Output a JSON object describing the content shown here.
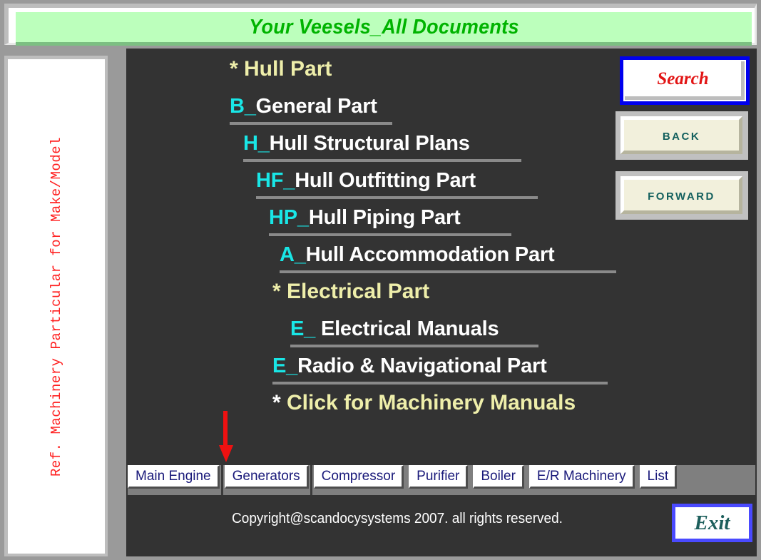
{
  "header": {
    "title": "Your Veesels_All Documents"
  },
  "sidebar": {
    "label": "Ref. Machinery Particular for Make/Model"
  },
  "main": {
    "menu": [
      {
        "kind": "section",
        "star": "*",
        "star_color": "cream",
        "text": "Hull Part",
        "indent": "ind-sec0"
      },
      {
        "kind": "item",
        "code": "B_",
        "label": "General Part",
        "indent": "ind-0",
        "rule_width": 228
      },
      {
        "kind": "item",
        "code": "H_",
        "label": "Hull Structural Plans",
        "indent": "ind-1",
        "rule_width": 390
      },
      {
        "kind": "item",
        "code": "HF_",
        "label": "Hull Outfitting Part",
        "indent": "ind-2",
        "rule_width": 395
      },
      {
        "kind": "item",
        "code": "HP_",
        "label": "Hull Piping Part",
        "indent": "ind-3",
        "rule_width": 340
      },
      {
        "kind": "item",
        "code": "A_",
        "label": "Hull Accommodation Part",
        "indent": "ind-4",
        "rule_width": 472
      },
      {
        "kind": "section",
        "star": "*",
        "star_color": "cream",
        "text": "Electrical Part",
        "indent": "ind-sec1"
      },
      {
        "kind": "item",
        "code": "E_ ",
        "label": "Electrical Manuals",
        "indent": "ind-5",
        "rule_width": 348
      },
      {
        "kind": "item",
        "code": "E_",
        "label": "Radio & Navigational Part",
        "indent": "ind-last",
        "rule_width": 470
      },
      {
        "kind": "section",
        "star": "*",
        "star_color": "white",
        "text": "Click for Machinery Manuals",
        "indent": "ind-sec1"
      }
    ],
    "buttons": {
      "search": "Search",
      "back": "BACK",
      "forward": "Forward",
      "exit": "Exit"
    },
    "tabs": [
      {
        "label": "Main Engine",
        "selected": false
      },
      {
        "label": "Generators",
        "selected": true
      },
      {
        "label": "Compressor",
        "selected": false
      },
      {
        "label": "Purifier",
        "selected": false
      },
      {
        "label": "Boiler",
        "selected": false
      },
      {
        "label": "E/R Machinery",
        "selected": false
      },
      {
        "label": "List",
        "selected": false
      }
    ],
    "copyright": "Copyright@scandocysystems 2007. all rights reserved."
  },
  "colors": {
    "panel_bg": "#333333",
    "title_bg": "#bcffbc",
    "title_text": "#00b300",
    "code_cyan": "#19e6e6",
    "section_cream": "#eeeeaa",
    "tab_text": "#19197a",
    "arrow_red": "#ee1111",
    "search_red": "#e21414",
    "exit_teal": "#1d5f5c",
    "nav_teal": "#14605e",
    "sidebar_red": "#ff2020"
  }
}
